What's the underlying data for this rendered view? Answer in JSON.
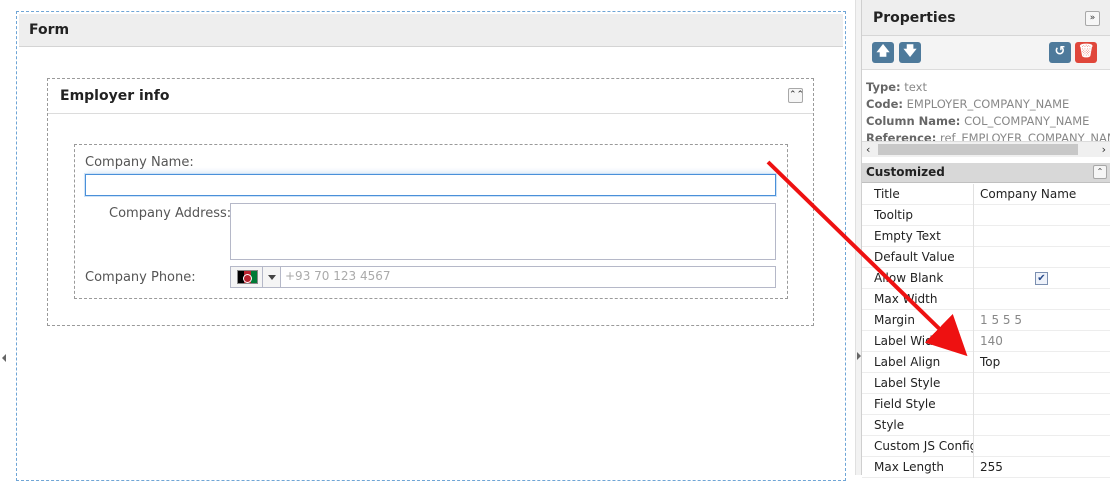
{
  "form": {
    "title": "Form",
    "fieldset": {
      "title": "Employer info",
      "collapse_icon": "collapse-up-icon",
      "fields": {
        "company_name_label": "Company Name:",
        "company_name_value": "",
        "company_address_label": "Company Address:",
        "company_address_value": "",
        "company_phone_label": "Company Phone:",
        "company_phone_placeholder": "+93 70 123 4567",
        "country_flag": "afghanistan-flag-icon"
      }
    }
  },
  "properties": {
    "title": "Properties",
    "expand_icon": "double-chevron-right-icon",
    "toolbar": {
      "up_icon": "arrow-up-icon",
      "down_icon": "arrow-down-icon",
      "reset_icon": "undo-icon",
      "delete_icon": "trash-icon"
    },
    "info": {
      "type_label": "Type:",
      "type_value": "text",
      "code_label": "Code:",
      "code_value": "EMPLOYER_COMPANY_NAME",
      "column_label": "Column Name:",
      "column_value": "COL_COMPANY_NAME",
      "reference_label": "Reference:",
      "reference_value": "ref_EMPLOYER_COMPANY_NAM"
    },
    "section_title": "Customized",
    "rows": [
      {
        "name": "Title",
        "value": "Company Name"
      },
      {
        "name": "Tooltip",
        "value": ""
      },
      {
        "name": "Empty Text",
        "value": ""
      },
      {
        "name": "Default Value",
        "value": ""
      },
      {
        "name": "Allow Blank",
        "value": ""
      },
      {
        "name": "Max Width",
        "value": ""
      },
      {
        "name": "Margin",
        "value": "1 5 5 5"
      },
      {
        "name": "Label Width",
        "value": "140"
      },
      {
        "name": "Label Align",
        "value": "Top"
      },
      {
        "name": "Label Style",
        "value": ""
      },
      {
        "name": "Field Style",
        "value": ""
      },
      {
        "name": "Style",
        "value": ""
      },
      {
        "name": "Custom JS Config",
        "value": ""
      },
      {
        "name": "Max Length",
        "value": "255"
      }
    ],
    "allow_blank_checked": true
  },
  "colors": {
    "accent_blue": "#4a90d9",
    "toolbar_blue": "#4e7a9b",
    "delete_red": "#e0473b",
    "annotation_arrow": "#ee1111"
  }
}
